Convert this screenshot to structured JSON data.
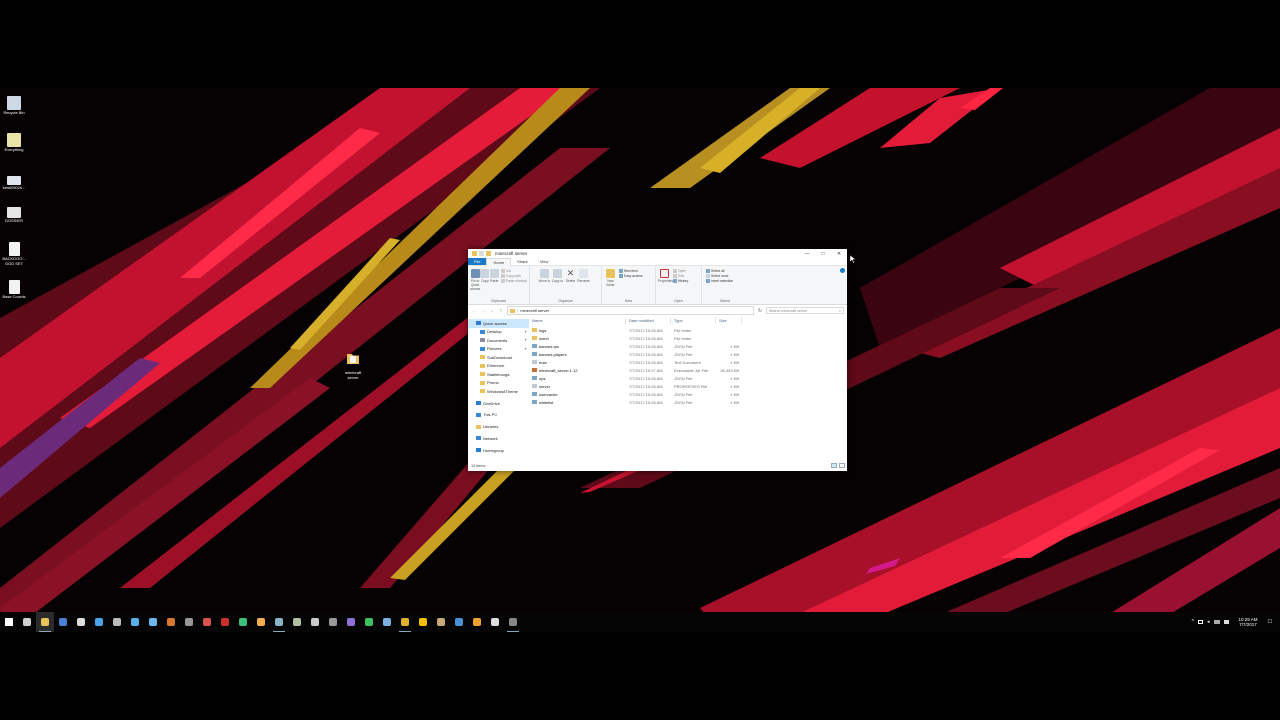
{
  "desktop": {
    "icons": [
      {
        "label": "Recycle Bin",
        "color": "#cfd8e6",
        "icon": "recycle-bin-icon"
      },
      {
        "label": "Everything",
        "color": "#e9e3a6",
        "icon": "everything-icon"
      },
      {
        "label": "besti0502s...",
        "color": "#dfe6ee",
        "icon": "image-file-icon"
      },
      {
        "label": "DOSSIER",
        "color": "#e6e6e6",
        "icon": "document-icon"
      },
      {
        "label": "BACKDOO... GOD SET",
        "color": "#f2f2f2",
        "icon": "text-file-icon"
      },
      {
        "label": "Base Coords",
        "color": "#f2f2f2",
        "icon": "text-file-icon"
      }
    ],
    "folder_shortcut": {
      "label": "minecraft server",
      "icon": "folder-icon"
    }
  },
  "explorer": {
    "title": "minecraft server",
    "window_buttons": [
      "—",
      "□",
      "✕"
    ],
    "tabs": [
      {
        "label": "File",
        "style": "file"
      },
      {
        "label": "Home",
        "style": "active"
      },
      {
        "label": "Share",
        "style": ""
      },
      {
        "label": "View",
        "style": ""
      }
    ],
    "ribbon": {
      "clipboard": {
        "pin_label": "Pin to Quick access",
        "copy_label": "Copy",
        "paste_label": "Paste",
        "cut_label": "Cut",
        "copy_path_label": "Copy path",
        "paste_shortcut_label": "Paste shortcut",
        "group_label": "Clipboard"
      },
      "organize": {
        "move_label": "Move to",
        "copy_to_label": "Copy to",
        "delete_label": "Delete",
        "rename_label": "Rename",
        "group_label": "Organize"
      },
      "new": {
        "new_folder_label": "New folder",
        "new_item_label": "New item",
        "easy_access_label": "Easy access",
        "group_label": "New"
      },
      "open": {
        "properties_label": "Properties",
        "open_label": "Open",
        "edit_label": "Edit",
        "history_label": "History",
        "group_label": "Open"
      },
      "select": {
        "select_all_label": "Select all",
        "select_none_label": "Select none",
        "invert_label": "Invert selection",
        "group_label": "Select"
      }
    },
    "address": {
      "path": "minecraft server",
      "search_placeholder": "Search minecraft server"
    },
    "nav_pane": [
      {
        "label": "Quick access",
        "indent": 0,
        "color": "#2a7ad6",
        "icon": "star-icon",
        "pinned": false,
        "selected": true
      },
      {
        "label": "Desktop",
        "indent": 1,
        "color": "#3a86d8",
        "icon": "desktop-icon",
        "pinned": true,
        "selected": false
      },
      {
        "label": "Documents",
        "indent": 1,
        "color": "#8a8f96",
        "icon": "documents-icon",
        "pinned": true,
        "selected": false
      },
      {
        "label": "Pictures",
        "indent": 1,
        "color": "#3a86d8",
        "icon": "pictures-icon",
        "pinned": true,
        "selected": false
      },
      {
        "label": "SubDownload",
        "indent": 1,
        "color": "#e8c25a",
        "icon": "folder-icon",
        "pinned": false,
        "selected": false
      },
      {
        "label": "Ethereum",
        "indent": 1,
        "color": "#e8c25a",
        "icon": "folder-icon",
        "pinned": false,
        "selected": false
      },
      {
        "label": "Stablebooga",
        "indent": 1,
        "color": "#e8c25a",
        "icon": "folder-icon",
        "pinned": false,
        "selected": false
      },
      {
        "label": "Promo",
        "indent": 1,
        "color": "#e8c25a",
        "icon": "folder-icon",
        "pinned": false,
        "selected": false
      },
      {
        "label": "Windows8Theme",
        "indent": 1,
        "color": "#e8c25a",
        "icon": "folder-icon",
        "pinned": false,
        "selected": false
      },
      {
        "label": "",
        "indent": 0,
        "color": "",
        "icon": "",
        "pinned": false,
        "selected": false
      },
      {
        "label": "OneDrive",
        "indent": 0,
        "color": "#2a7ad6",
        "icon": "cloud-icon",
        "pinned": false,
        "selected": false
      },
      {
        "label": "",
        "indent": 0,
        "color": "",
        "icon": "",
        "pinned": false,
        "selected": false
      },
      {
        "label": "This PC",
        "indent": 0,
        "color": "#3a86d8",
        "icon": "computer-icon",
        "pinned": false,
        "selected": false
      },
      {
        "label": "",
        "indent": 0,
        "color": "",
        "icon": "",
        "pinned": false,
        "selected": false
      },
      {
        "label": "Libraries",
        "indent": 0,
        "color": "#e8c25a",
        "icon": "library-icon",
        "pinned": false,
        "selected": false
      },
      {
        "label": "",
        "indent": 0,
        "color": "",
        "icon": "",
        "pinned": false,
        "selected": false
      },
      {
        "label": "Network",
        "indent": 0,
        "color": "#3a86d8",
        "icon": "network-icon",
        "pinned": false,
        "selected": false
      },
      {
        "label": "",
        "indent": 0,
        "color": "",
        "icon": "",
        "pinned": false,
        "selected": false
      },
      {
        "label": "Homegroup",
        "indent": 0,
        "color": "#2a7ad6",
        "icon": "homegroup-icon",
        "pinned": false,
        "selected": false
      }
    ],
    "columns": {
      "name": "Name",
      "date": "Date modified",
      "type": "Type",
      "size": "Size"
    },
    "files": [
      {
        "name": "logs",
        "date": "7/7/2017 10:28 AM",
        "type": "File folder",
        "size": "",
        "icon": "folder",
        "color": "#e8c25a"
      },
      {
        "name": "world",
        "date": "7/7/2017 10:28 AM",
        "type": "File folder",
        "size": "",
        "icon": "folder",
        "color": "#e8c25a"
      },
      {
        "name": "banned-ips",
        "date": "7/7/2017 10:28 AM",
        "type": "JSON File",
        "size": "1 KB",
        "icon": "file",
        "color": "#7aa7c7"
      },
      {
        "name": "banned-players",
        "date": "7/7/2017 10:28 AM",
        "type": "JSON File",
        "size": "1 KB",
        "icon": "file",
        "color": "#7aa7c7"
      },
      {
        "name": "eula",
        "date": "7/7/2017 10:28 AM",
        "type": "Text Document",
        "size": "1 KB",
        "icon": "file",
        "color": "#bfc7cf"
      },
      {
        "name": "minecraft_server.1.12",
        "date": "7/7/2017 10:27 AM",
        "type": "Executable Jar File",
        "size": "26,493 KB",
        "icon": "file",
        "color": "#c86c3c"
      },
      {
        "name": "ops",
        "date": "7/7/2017 10:28 AM",
        "type": "JSON File",
        "size": "1 KB",
        "icon": "file",
        "color": "#7aa7c7"
      },
      {
        "name": "server",
        "date": "7/7/2017 10:28 AM",
        "type": "PROPERTIES File",
        "size": "1 KB",
        "icon": "file",
        "color": "#bfc7cf"
      },
      {
        "name": "usercache",
        "date": "7/7/2017 10:28 AM",
        "type": "JSON File",
        "size": "1 KB",
        "icon": "file",
        "color": "#7aa7c7"
      },
      {
        "name": "whitelist",
        "date": "7/7/2017 10:28 AM",
        "type": "JSON File",
        "size": "1 KB",
        "icon": "file",
        "color": "#7aa7c7"
      }
    ],
    "status": "10 items"
  },
  "taskbar": {
    "apps": [
      {
        "name": "start-button",
        "color": "#ffffff",
        "active": false,
        "running": false
      },
      {
        "name": "task-view-icon",
        "color": "#d0d0d0",
        "active": false,
        "running": false
      },
      {
        "name": "file-explorer-icon",
        "color": "#e8c25a",
        "active": true,
        "running": true
      },
      {
        "name": "store-icon",
        "color": "#4a7fd6",
        "active": false,
        "running": false
      },
      {
        "name": "settings-icon",
        "color": "#dddddd",
        "active": false,
        "running": false
      },
      {
        "name": "mail-icon",
        "color": "#4aa3e6",
        "active": false,
        "running": false
      },
      {
        "name": "calculator-icon",
        "color": "#bbbbbb",
        "active": false,
        "running": false
      },
      {
        "name": "steam-icon",
        "color": "#5ab0e8",
        "active": false,
        "running": false
      },
      {
        "name": "vpn-icon",
        "color": "#6fb6f0",
        "active": false,
        "running": false
      },
      {
        "name": "app-icon",
        "color": "#d9792f",
        "active": false,
        "running": false
      },
      {
        "name": "app-icon",
        "color": "#999999",
        "active": false,
        "running": false
      },
      {
        "name": "app-icon",
        "color": "#d9534f",
        "active": false,
        "running": false
      },
      {
        "name": "app-icon",
        "color": "#c9302c",
        "active": false,
        "running": false
      },
      {
        "name": "headphones-icon",
        "color": "#3cbf7c",
        "active": false,
        "running": false
      },
      {
        "name": "app-icon",
        "color": "#f0ad4e",
        "active": false,
        "running": false
      },
      {
        "name": "app-icon",
        "color": "#8ab4c8",
        "active": false,
        "running": true
      },
      {
        "name": "app-icon",
        "color": "#b0c0a0",
        "active": false,
        "running": false
      },
      {
        "name": "app-icon",
        "color": "#cccccc",
        "active": false,
        "running": false
      },
      {
        "name": "app-icon",
        "color": "#9a9a9a",
        "active": false,
        "running": false
      },
      {
        "name": "app-icon",
        "color": "#8e6fd6",
        "active": false,
        "running": false
      },
      {
        "name": "app-icon",
        "color": "#3fbf5f",
        "active": false,
        "running": false
      },
      {
        "name": "app-icon",
        "color": "#7faee6",
        "active": false,
        "running": false
      },
      {
        "name": "chrome-icon",
        "color": "#e0b030",
        "active": false,
        "running": true
      },
      {
        "name": "app-icon",
        "color": "#f0c000",
        "active": false,
        "running": false
      },
      {
        "name": "app-icon",
        "color": "#c8a878",
        "active": false,
        "running": false
      },
      {
        "name": "app-icon",
        "color": "#4a90d6",
        "active": false,
        "running": false
      },
      {
        "name": "app-icon",
        "color": "#f0a030",
        "active": false,
        "running": false
      },
      {
        "name": "app-icon",
        "color": "#dddddd",
        "active": false,
        "running": false
      },
      {
        "name": "terminal-icon",
        "color": "#888888",
        "active": false,
        "running": true
      }
    ],
    "tray": {
      "chevron": "^",
      "time": "10:29 AM",
      "date": "7/7/2017",
      "notification": "☐"
    }
  }
}
